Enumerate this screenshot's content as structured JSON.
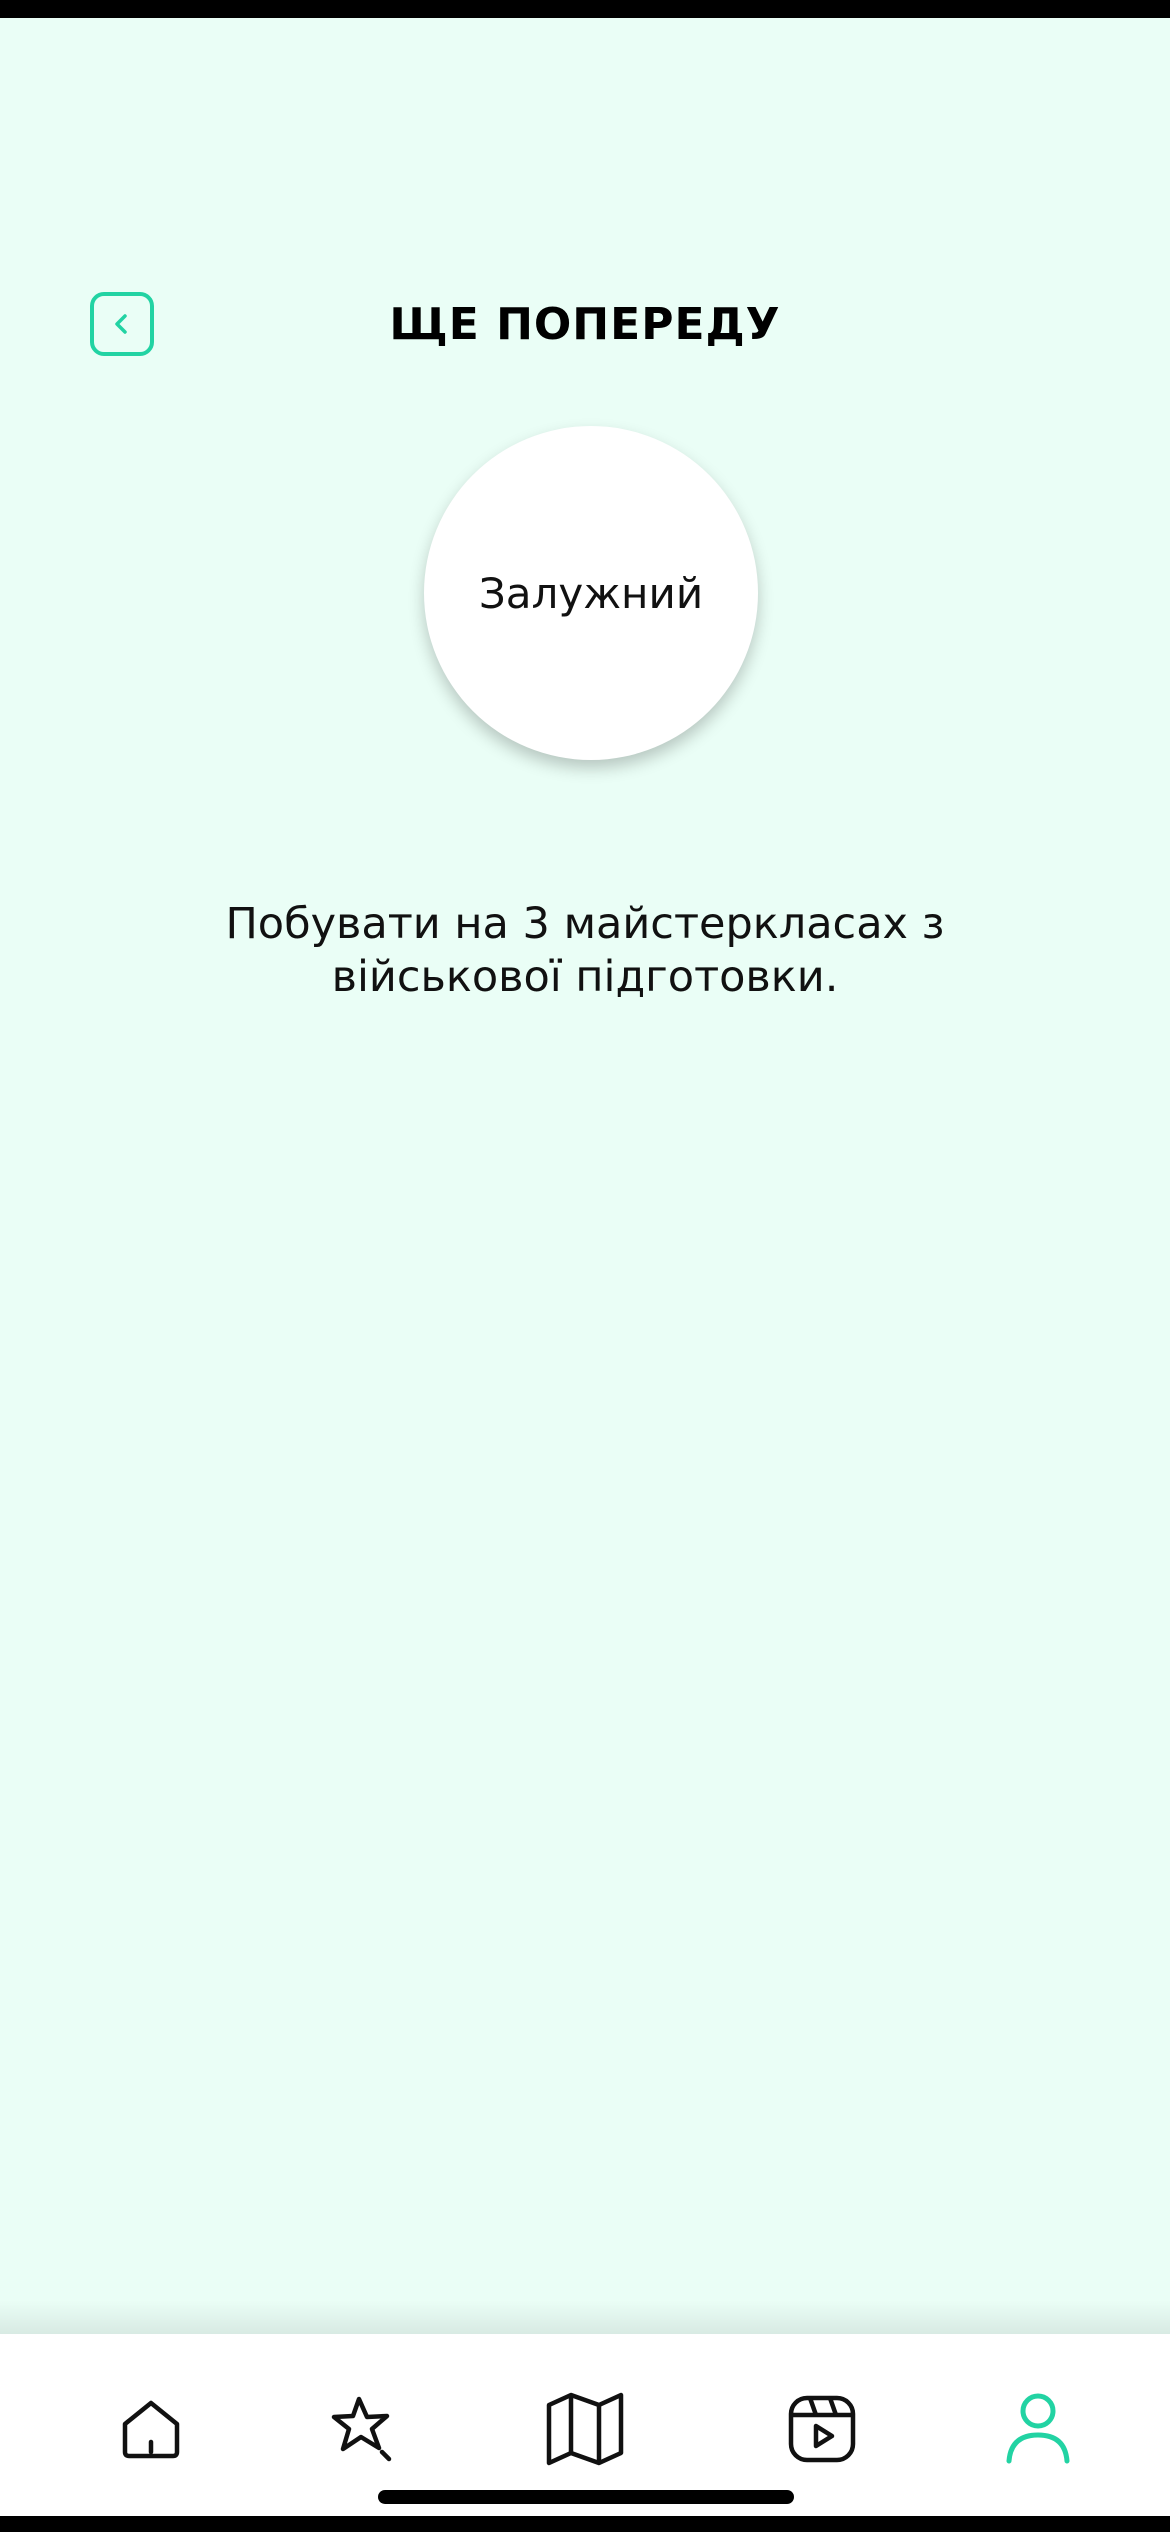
{
  "header": {
    "title": "ЩЕ ПОПЕРЕДУ"
  },
  "badge": {
    "label": "Залужний"
  },
  "description": {
    "text": "Побувати на 3 майстеркласах з військової підготовки."
  },
  "colors": {
    "background": "#eafef6",
    "accent": "#22d3a3",
    "nav_background": "#ffffff"
  },
  "bottom_nav": {
    "items": [
      {
        "icon": "home-icon",
        "active": false
      },
      {
        "icon": "star-icon",
        "active": false
      },
      {
        "icon": "map-icon",
        "active": false
      },
      {
        "icon": "video-icon",
        "active": false
      },
      {
        "icon": "profile-icon",
        "active": true
      }
    ]
  }
}
